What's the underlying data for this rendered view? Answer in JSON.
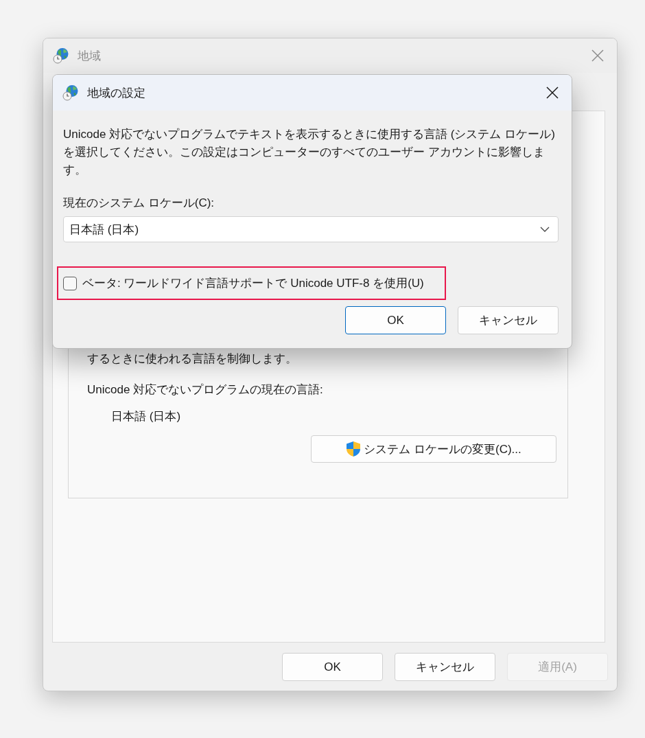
{
  "main_window": {
    "title": "地域",
    "active": false,
    "group": {
      "description_tail": "するときに使われる言語を制御します。",
      "current_language_label": "Unicode 対応でないプログラムの現在の言語:",
      "current_language": "日本語 (日本)",
      "change_button": {
        "label": "システム ロケールの変更(C)..."
      }
    },
    "buttons": [
      {
        "label": "OK",
        "disabled": false
      },
      {
        "label": "キャンセル",
        "disabled": false
      },
      {
        "label": "適用(A)",
        "disabled": true
      }
    ]
  },
  "locale_dialog": {
    "title": "地域の設定",
    "active": true,
    "description": "Unicode 対応でないプログラムでテキストを表示するときに使用する言語 (システム ロケール) を選択してください。この設定はコンピューターのすべてのユーザー アカウントに影響します。",
    "locale_label": "現在のシステム ロケール(C):",
    "locale_select": {
      "value": "日本語 (日本)"
    },
    "utf8_option": {
      "label": "ベータ: ワールドワイド言語サポートで Unicode UTF-8 を使用(U)",
      "checked": false,
      "highlighted": true
    },
    "buttons": [
      {
        "label": "OK",
        "default": true
      },
      {
        "label": "キャンセル",
        "default": false
      }
    ]
  }
}
